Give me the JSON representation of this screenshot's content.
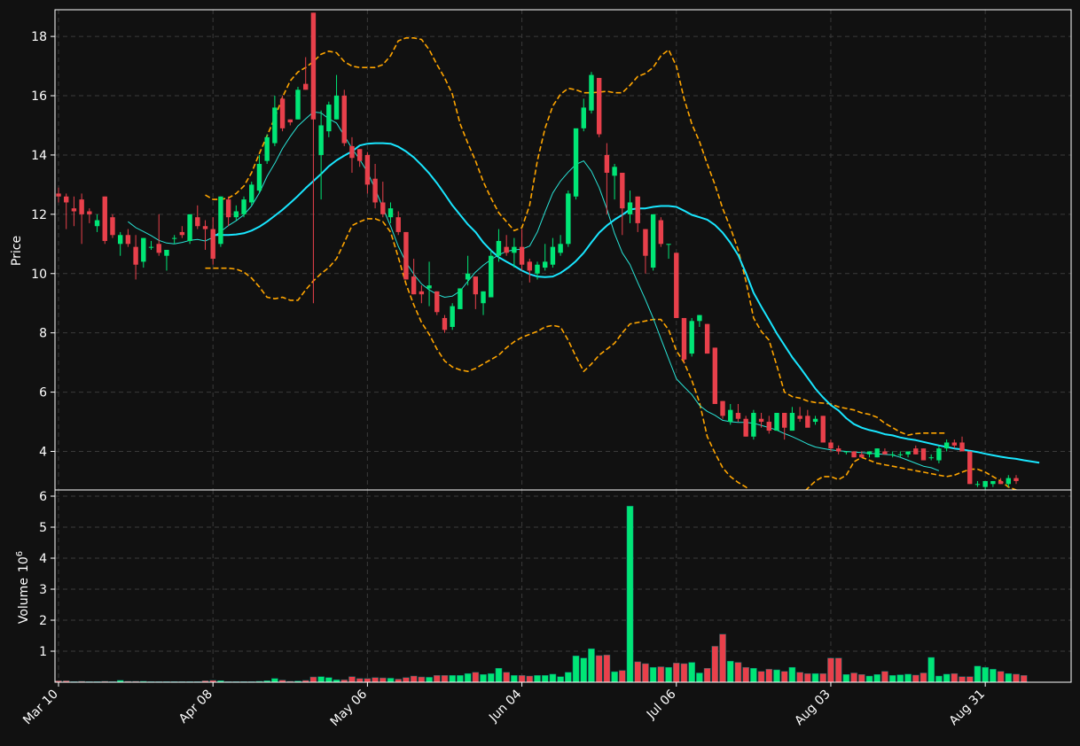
{
  "chart_data": {
    "type": "candlestick",
    "colors": {
      "background": "#111111",
      "up": "#00e676",
      "down": "#e8404b",
      "grid": "#3a3a3a",
      "frame": "#ffffff",
      "ma_fast": "#29e3d6",
      "ma_slow": "#19e6ff",
      "bollinger": "#ffa500",
      "text": "#ffffff"
    },
    "x_tick_labels": [
      "Mar 10",
      "Apr 08",
      "May 06",
      "Jun 04",
      "Jul 06",
      "Aug 03",
      "Aug 31"
    ],
    "x_tick_indices": [
      0,
      20,
      40,
      60,
      80,
      100,
      120
    ],
    "price_panel": {
      "ylabel": "Price",
      "yticks": [
        4,
        6,
        8,
        10,
        12,
        14,
        16,
        18
      ],
      "ylim": [
        2.7,
        18.9
      ]
    },
    "volume_panel": {
      "ylabel": "Volume",
      "ylabel_exponent": "10",
      "ylabel_exponent_power": "6",
      "yticks": [
        1,
        2,
        3,
        4,
        5,
        6
      ],
      "ylim": [
        0,
        6.2
      ]
    },
    "candles": [
      {
        "o": 12.7,
        "h": 12.9,
        "l": 12.4,
        "c": 12.6
      },
      {
        "o": 12.6,
        "h": 12.7,
        "l": 11.5,
        "c": 12.4
      },
      {
        "o": 12.2,
        "h": 12.6,
        "l": 11.6,
        "c": 12.1
      },
      {
        "o": 12.5,
        "h": 12.7,
        "l": 11.0,
        "c": 12.0
      },
      {
        "o": 12.1,
        "h": 12.2,
        "l": 11.7,
        "c": 12.0
      },
      {
        "o": 11.6,
        "h": 12.0,
        "l": 11.4,
        "c": 11.8
      },
      {
        "o": 12.6,
        "h": 12.6,
        "l": 11.0,
        "c": 11.1
      },
      {
        "o": 11.9,
        "h": 12.0,
        "l": 11.2,
        "c": 11.3
      },
      {
        "o": 11.0,
        "h": 11.4,
        "l": 10.6,
        "c": 11.3
      },
      {
        "o": 11.3,
        "h": 11.5,
        "l": 10.9,
        "c": 11.0
      },
      {
        "o": 10.9,
        "h": 11.3,
        "l": 9.8,
        "c": 10.3
      },
      {
        "o": 10.4,
        "h": 11.2,
        "l": 10.2,
        "c": 11.2
      },
      {
        "o": 10.9,
        "h": 11.1,
        "l": 10.8,
        "c": 10.9
      },
      {
        "o": 11.0,
        "h": 12.0,
        "l": 10.6,
        "c": 10.7
      },
      {
        "o": 10.6,
        "h": 10.8,
        "l": 10.1,
        "c": 10.8
      },
      {
        "o": 11.2,
        "h": 11.3,
        "l": 11.0,
        "c": 11.2
      },
      {
        "o": 11.4,
        "h": 11.6,
        "l": 11.2,
        "c": 11.3
      },
      {
        "o": 11.1,
        "h": 12.0,
        "l": 11.0,
        "c": 12.0
      },
      {
        "o": 11.9,
        "h": 12.3,
        "l": 11.5,
        "c": 11.6
      },
      {
        "o": 11.6,
        "h": 11.8,
        "l": 10.8,
        "c": 11.5
      },
      {
        "o": 11.5,
        "h": 11.9,
        "l": 10.3,
        "c": 10.5
      },
      {
        "o": 11.0,
        "h": 12.6,
        "l": 10.9,
        "c": 12.6
      },
      {
        "o": 12.5,
        "h": 12.6,
        "l": 11.6,
        "c": 11.9
      },
      {
        "o": 11.9,
        "h": 12.3,
        "l": 11.8,
        "c": 12.1
      },
      {
        "o": 12.0,
        "h": 12.6,
        "l": 11.9,
        "c": 12.5
      },
      {
        "o": 12.4,
        "h": 13.1,
        "l": 12.3,
        "c": 13.0
      },
      {
        "o": 12.8,
        "h": 14.0,
        "l": 12.7,
        "c": 13.7
      },
      {
        "o": 13.8,
        "h": 14.7,
        "l": 13.7,
        "c": 14.6
      },
      {
        "o": 14.4,
        "h": 16.0,
        "l": 14.3,
        "c": 15.6
      },
      {
        "o": 15.9,
        "h": 16.0,
        "l": 14.8,
        "c": 14.9
      },
      {
        "o": 15.2,
        "h": 15.2,
        "l": 15.0,
        "c": 15.1
      },
      {
        "o": 15.2,
        "h": 16.3,
        "l": 15.2,
        "c": 16.2
      },
      {
        "o": 16.4,
        "h": 17.3,
        "l": 16.2,
        "c": 16.2
      },
      {
        "o": 18.8,
        "h": 18.8,
        "l": 9.0,
        "c": 15.2
      },
      {
        "o": 14.0,
        "h": 15.5,
        "l": 12.5,
        "c": 15.0
      },
      {
        "o": 14.8,
        "h": 15.8,
        "l": 14.6,
        "c": 15.7
      },
      {
        "o": 15.2,
        "h": 16.7,
        "l": 15.2,
        "c": 16.0
      },
      {
        "o": 16.0,
        "h": 16.2,
        "l": 14.3,
        "c": 14.4
      },
      {
        "o": 14.3,
        "h": 14.6,
        "l": 13.4,
        "c": 13.9
      },
      {
        "o": 14.2,
        "h": 14.2,
        "l": 13.6,
        "c": 13.8
      },
      {
        "o": 14.0,
        "h": 14.1,
        "l": 12.7,
        "c": 13.0
      },
      {
        "o": 13.2,
        "h": 13.7,
        "l": 12.2,
        "c": 12.4
      },
      {
        "o": 12.4,
        "h": 13.1,
        "l": 11.9,
        "c": 12.0
      },
      {
        "o": 11.9,
        "h": 12.4,
        "l": 11.7,
        "c": 12.2
      },
      {
        "o": 11.9,
        "h": 12.1,
        "l": 11.3,
        "c": 11.4
      },
      {
        "o": 11.4,
        "h": 11.4,
        "l": 9.8,
        "c": 9.8
      },
      {
        "o": 9.9,
        "h": 10.5,
        "l": 9.3,
        "c": 9.3
      },
      {
        "o": 9.4,
        "h": 9.6,
        "l": 9.0,
        "c": 9.3
      },
      {
        "o": 9.5,
        "h": 10.4,
        "l": 8.9,
        "c": 9.6
      },
      {
        "o": 9.4,
        "h": 9.4,
        "l": 8.6,
        "c": 8.7
      },
      {
        "o": 8.5,
        "h": 8.6,
        "l": 8.0,
        "c": 8.1
      },
      {
        "o": 8.2,
        "h": 9.0,
        "l": 8.1,
        "c": 8.9
      },
      {
        "o": 8.8,
        "h": 9.5,
        "l": 8.8,
        "c": 9.5
      },
      {
        "o": 9.8,
        "h": 10.6,
        "l": 9.6,
        "c": 10.0
      },
      {
        "o": 9.9,
        "h": 9.9,
        "l": 8.8,
        "c": 9.3
      },
      {
        "o": 9.0,
        "h": 9.4,
        "l": 8.6,
        "c": 9.4
      },
      {
        "o": 9.2,
        "h": 10.8,
        "l": 9.2,
        "c": 10.6
      },
      {
        "o": 10.6,
        "h": 11.5,
        "l": 10.4,
        "c": 11.1
      },
      {
        "o": 10.9,
        "h": 11.3,
        "l": 10.6,
        "c": 10.7
      },
      {
        "o": 10.7,
        "h": 11.2,
        "l": 10.2,
        "c": 10.9
      },
      {
        "o": 10.9,
        "h": 11.5,
        "l": 10.1,
        "c": 10.3
      },
      {
        "o": 10.4,
        "h": 10.5,
        "l": 9.7,
        "c": 10.1
      },
      {
        "o": 10.0,
        "h": 10.4,
        "l": 9.8,
        "c": 10.3
      },
      {
        "o": 10.2,
        "h": 11.0,
        "l": 10.1,
        "c": 10.4
      },
      {
        "o": 10.3,
        "h": 11.2,
        "l": 10.2,
        "c": 10.9
      },
      {
        "o": 10.7,
        "h": 11.3,
        "l": 10.6,
        "c": 11.0
      },
      {
        "o": 11.0,
        "h": 12.8,
        "l": 10.9,
        "c": 12.7
      },
      {
        "o": 12.6,
        "h": 14.8,
        "l": 12.5,
        "c": 14.9
      },
      {
        "o": 14.9,
        "h": 15.9,
        "l": 14.8,
        "c": 15.6
      },
      {
        "o": 15.5,
        "h": 16.8,
        "l": 15.4,
        "c": 16.7
      },
      {
        "o": 16.6,
        "h": 16.6,
        "l": 14.6,
        "c": 14.7
      },
      {
        "o": 14.0,
        "h": 14.4,
        "l": 12.0,
        "c": 13.4
      },
      {
        "o": 13.3,
        "h": 13.7,
        "l": 12.5,
        "c": 13.6
      },
      {
        "o": 13.4,
        "h": 13.4,
        "l": 11.3,
        "c": 12.2
      },
      {
        "o": 12.0,
        "h": 12.8,
        "l": 11.7,
        "c": 12.4
      },
      {
        "o": 12.6,
        "h": 12.6,
        "l": 11.4,
        "c": 11.7
      },
      {
        "o": 11.5,
        "h": 11.5,
        "l": 10.0,
        "c": 10.6
      },
      {
        "o": 10.2,
        "h": 12.0,
        "l": 10.1,
        "c": 12.0
      },
      {
        "o": 11.8,
        "h": 11.9,
        "l": 10.9,
        "c": 11.0
      },
      {
        "o": 11.0,
        "h": 11.0,
        "l": 10.5,
        "c": 11.0
      },
      {
        "o": 10.7,
        "h": 10.7,
        "l": 8.5,
        "c": 8.5
      },
      {
        "o": 8.5,
        "h": 8.5,
        "l": 7.0,
        "c": 7.1
      },
      {
        "o": 7.3,
        "h": 8.5,
        "l": 7.2,
        "c": 8.4
      },
      {
        "o": 8.4,
        "h": 8.6,
        "l": 8.2,
        "c": 8.6
      },
      {
        "o": 8.3,
        "h": 8.3,
        "l": 7.3,
        "c": 7.3
      },
      {
        "o": 7.5,
        "h": 7.5,
        "l": 5.6,
        "c": 5.6
      },
      {
        "o": 5.7,
        "h": 5.7,
        "l": 5.1,
        "c": 5.2
      },
      {
        "o": 5.0,
        "h": 5.6,
        "l": 4.9,
        "c": 5.4
      },
      {
        "o": 5.3,
        "h": 5.6,
        "l": 5.0,
        "c": 5.1
      },
      {
        "o": 5.1,
        "h": 5.2,
        "l": 4.5,
        "c": 4.5
      },
      {
        "o": 4.5,
        "h": 5.4,
        "l": 4.4,
        "c": 5.3
      },
      {
        "o": 5.1,
        "h": 5.3,
        "l": 4.8,
        "c": 5.0
      },
      {
        "o": 5.0,
        "h": 5.2,
        "l": 4.6,
        "c": 4.7
      },
      {
        "o": 4.7,
        "h": 5.3,
        "l": 4.7,
        "c": 5.3
      },
      {
        "o": 5.3,
        "h": 5.3,
        "l": 4.4,
        "c": 4.8
      },
      {
        "o": 4.7,
        "h": 5.5,
        "l": 4.7,
        "c": 5.3
      },
      {
        "o": 5.2,
        "h": 5.5,
        "l": 5.0,
        "c": 5.1
      },
      {
        "o": 5.2,
        "h": 5.4,
        "l": 4.9,
        "c": 4.8
      },
      {
        "o": 5.0,
        "h": 5.2,
        "l": 4.9,
        "c": 5.1
      },
      {
        "o": 5.2,
        "h": 5.2,
        "l": 4.3,
        "c": 4.3
      },
      {
        "o": 4.3,
        "h": 4.4,
        "l": 4.0,
        "c": 4.1
      },
      {
        "o": 4.1,
        "h": 4.2,
        "l": 3.9,
        "c": 4.0
      },
      {
        "o": 4.0,
        "h": 4.0,
        "l": 3.9,
        "c": 4.0
      },
      {
        "o": 4.0,
        "h": 4.0,
        "l": 3.8,
        "c": 3.8
      },
      {
        "o": 3.9,
        "h": 4.0,
        "l": 3.8,
        "c": 3.8
      },
      {
        "o": 3.9,
        "h": 4.0,
        "l": 3.8,
        "c": 4.0
      },
      {
        "o": 3.8,
        "h": 4.1,
        "l": 3.8,
        "c": 4.1
      },
      {
        "o": 4.0,
        "h": 4.1,
        "l": 3.9,
        "c": 3.9
      },
      {
        "o": 3.9,
        "h": 4.0,
        "l": 3.8,
        "c": 3.9
      },
      {
        "o": 3.9,
        "h": 4.0,
        "l": 3.8,
        "c": 3.9
      },
      {
        "o": 3.9,
        "h": 4.0,
        "l": 3.8,
        "c": 4.0
      },
      {
        "o": 4.1,
        "h": 4.2,
        "l": 3.9,
        "c": 3.9
      },
      {
        "o": 4.1,
        "h": 4.1,
        "l": 3.7,
        "c": 3.7
      },
      {
        "o": 3.8,
        "h": 3.9,
        "l": 3.7,
        "c": 3.8
      },
      {
        "o": 3.7,
        "h": 4.2,
        "l": 3.6,
        "c": 4.1
      },
      {
        "o": 4.1,
        "h": 4.4,
        "l": 4.0,
        "c": 4.3
      },
      {
        "o": 4.3,
        "h": 4.4,
        "l": 4.1,
        "c": 4.2
      },
      {
        "o": 4.3,
        "h": 4.5,
        "l": 4.0,
        "c": 4.0
      },
      {
        "o": 4.0,
        "h": 4.0,
        "l": 2.9,
        "c": 2.9
      },
      {
        "o": 2.9,
        "h": 3.0,
        "l": 2.8,
        "c": 2.9
      },
      {
        "o": 2.8,
        "h": 3.0,
        "l": 2.7,
        "c": 3.0
      },
      {
        "o": 2.9,
        "h": 3.0,
        "l": 2.8,
        "c": 3.0
      },
      {
        "o": 3.0,
        "h": 3.1,
        "l": 2.9,
        "c": 2.9
      },
      {
        "o": 2.9,
        "h": 3.2,
        "l": 2.8,
        "c": 3.1
      },
      {
        "o": 3.1,
        "h": 3.2,
        "l": 2.9,
        "c": 3.0
      }
    ],
    "volume": [
      0.05,
      0.05,
      0.02,
      0.03,
      0.02,
      0.02,
      0.03,
      0.02,
      0.06,
      0.03,
      0.03,
      0.03,
      0.02,
      0.02,
      0.02,
      0.02,
      0.02,
      0.02,
      0.02,
      0.05,
      0.06,
      0.05,
      0.02,
      0.02,
      0.02,
      0.02,
      0.03,
      0.05,
      0.12,
      0.07,
      0.03,
      0.04,
      0.06,
      0.17,
      0.18,
      0.15,
      0.08,
      0.08,
      0.18,
      0.12,
      0.12,
      0.15,
      0.14,
      0.13,
      0.1,
      0.15,
      0.2,
      0.17,
      0.16,
      0.22,
      0.22,
      0.22,
      0.22,
      0.28,
      0.32,
      0.25,
      0.28,
      0.45,
      0.32,
      0.22,
      0.22,
      0.2,
      0.22,
      0.22,
      0.26,
      0.18,
      0.32,
      0.85,
      0.78,
      1.08,
      0.86,
      0.88,
      0.34,
      0.38,
      5.68,
      0.66,
      0.6,
      0.48,
      0.5,
      0.48,
      0.62,
      0.6,
      0.64,
      0.3,
      0.45,
      1.16,
      1.55,
      0.68,
      0.64,
      0.48,
      0.45,
      0.35,
      0.42,
      0.4,
      0.35,
      0.48,
      0.32,
      0.28,
      0.28,
      0.28,
      0.78,
      0.78,
      0.25,
      0.3,
      0.25,
      0.2,
      0.25,
      0.35,
      0.22,
      0.24,
      0.26,
      0.23,
      0.3,
      0.8,
      0.2,
      0.26,
      0.28,
      0.18,
      0.18,
      0.52,
      0.48,
      0.42,
      0.35,
      0.28,
      0.26,
      0.22
    ],
    "ma_fast_start": 9,
    "ma_fast": [
      11.75,
      11.55,
      11.42,
      11.28,
      11.12,
      11.03,
      11.0,
      11.05,
      11.12,
      11.15,
      11.1,
      11.22,
      11.42,
      11.62,
      11.78,
      11.98,
      12.28,
      12.72,
      13.28,
      13.72,
      14.22,
      14.62,
      14.98,
      15.22,
      15.45,
      15.42,
      15.22,
      15.08,
      14.65,
      14.22,
      13.85,
      13.42,
      12.85,
      12.22,
      11.6,
      10.92,
      10.38,
      9.98,
      9.65,
      9.45,
      9.3,
      9.2,
      9.24,
      9.41,
      9.74,
      10.05,
      10.28,
      10.47,
      10.63,
      10.75,
      10.8,
      10.82,
      10.93,
      11.4,
      12.08,
      12.72,
      13.12,
      13.42,
      13.68,
      13.8,
      13.45,
      12.9,
      12.18,
      11.35,
      10.7,
      10.3,
      9.7,
      9.12,
      8.5,
      7.8,
      7.12,
      6.45,
      6.18,
      5.92,
      5.55,
      5.35,
      5.22,
      5.05,
      5.0,
      4.98,
      4.98,
      4.95,
      4.88,
      4.8,
      4.72,
      4.6,
      4.5,
      4.38,
      4.25,
      4.15,
      4.1,
      4.05,
      4.02,
      4.0,
      3.98,
      3.96,
      3.94,
      3.92,
      3.9,
      3.88,
      3.8,
      3.7,
      3.6,
      3.5,
      3.45,
      3.35
    ],
    "ma_slow_start": 20,
    "ma_slow": [
      11.3,
      11.3,
      11.3,
      11.32,
      11.36,
      11.45,
      11.58,
      11.75,
      11.95,
      12.15,
      12.38,
      12.62,
      12.88,
      13.12,
      13.36,
      13.62,
      13.82,
      13.98,
      14.12,
      14.32,
      14.38,
      14.4,
      14.4,
      14.38,
      14.28,
      14.12,
      13.92,
      13.66,
      13.38,
      13.05,
      12.68,
      12.3,
      11.98,
      11.66,
      11.4,
      11.05,
      10.78,
      10.55,
      10.4,
      10.26,
      10.1,
      9.98,
      9.9,
      9.88,
      9.9,
      10.02,
      10.2,
      10.42,
      10.7,
      11.05,
      11.38,
      11.62,
      11.82,
      11.98,
      12.16,
      12.2,
      12.2,
      12.25,
      12.28,
      12.28,
      12.25,
      12.12,
      11.98,
      11.9,
      11.82,
      11.64,
      11.38,
      11.04,
      10.62,
      10.02,
      9.35,
      8.88,
      8.44,
      7.98,
      7.58,
      7.18,
      6.84,
      6.48,
      6.12,
      5.82,
      5.56,
      5.38,
      5.12,
      4.92,
      4.8,
      4.72,
      4.66,
      4.58,
      4.54,
      4.47,
      4.42,
      4.38,
      4.32,
      4.26,
      4.2,
      4.15,
      4.1,
      4.07,
      4.02,
      3.98,
      3.92,
      3.87,
      3.82,
      3.78,
      3.75,
      3.7,
      3.66,
      3.62
    ],
    "bb_upper_start": 19,
    "bb_upper": [
      12.65,
      12.5,
      12.5,
      12.55,
      12.7,
      12.95,
      13.4,
      14.05,
      14.65,
      15.25,
      15.95,
      16.5,
      16.8,
      16.95,
      17.15,
      17.4,
      17.5,
      17.45,
      17.15,
      17.0,
      16.95,
      16.95,
      16.95,
      17.05,
      17.35,
      17.85,
      17.95,
      17.95,
      17.9,
      17.55,
      17.05,
      16.6,
      16.05,
      15.05,
      14.4,
      13.8,
      13.1,
      12.55,
      12.05,
      11.75,
      11.45,
      11.55,
      12.3,
      13.8,
      14.9,
      15.65,
      16.05,
      16.25,
      16.2,
      16.1,
      16.1,
      16.12,
      16.15,
      16.1,
      16.1,
      16.35,
      16.65,
      16.75,
      16.95,
      17.35,
      17.55,
      17.0,
      15.9,
      15.05,
      14.45,
      13.7,
      13.0,
      12.2,
      11.55,
      10.8,
      9.75,
      8.5,
      8.05,
      7.75,
      6.9,
      6.0,
      5.85,
      5.8,
      5.7,
      5.65,
      5.63,
      5.6,
      5.5,
      5.45,
      5.4,
      5.3,
      5.25,
      5.15,
      4.95,
      4.8,
      4.65,
      4.55,
      4.6,
      4.62,
      4.62,
      4.62,
      4.62
    ],
    "bb_lower_start": 19,
    "bb_lower": [
      10.18,
      10.18,
      10.18,
      10.18,
      10.15,
      10.05,
      9.85,
      9.55,
      9.2,
      9.15,
      9.2,
      9.1,
      9.1,
      9.45,
      9.75,
      10.0,
      10.2,
      10.5,
      11.05,
      11.62,
      11.75,
      11.85,
      11.85,
      11.75,
      11.4,
      10.55,
      9.65,
      8.95,
      8.35,
      7.95,
      7.45,
      7.05,
      6.85,
      6.75,
      6.7,
      6.8,
      6.95,
      7.1,
      7.25,
      7.5,
      7.7,
      7.85,
      7.95,
      8.05,
      8.2,
      8.25,
      8.2,
      7.75,
      7.2,
      6.7,
      6.95,
      7.25,
      7.45,
      7.65,
      8.0,
      8.3,
      8.35,
      8.4,
      8.45,
      8.45,
      8.1,
      7.4,
      7.0,
      6.4,
      5.65,
      4.5,
      3.95,
      3.45,
      3.15,
      2.95,
      2.8,
      2.55,
      2.25,
      2.05,
      2.0,
      2.05,
      2.2,
      2.5,
      2.75,
      3.0,
      3.15,
      3.15,
      3.05,
      3.2,
      3.65,
      3.8,
      3.7,
      3.6,
      3.55,
      3.5,
      3.45,
      3.4,
      3.35,
      3.3,
      3.25,
      3.2,
      3.15,
      3.2,
      3.3,
      3.4,
      3.4,
      3.3,
      3.15,
      3.0,
      2.8,
      2.7,
      2.55
    ]
  }
}
